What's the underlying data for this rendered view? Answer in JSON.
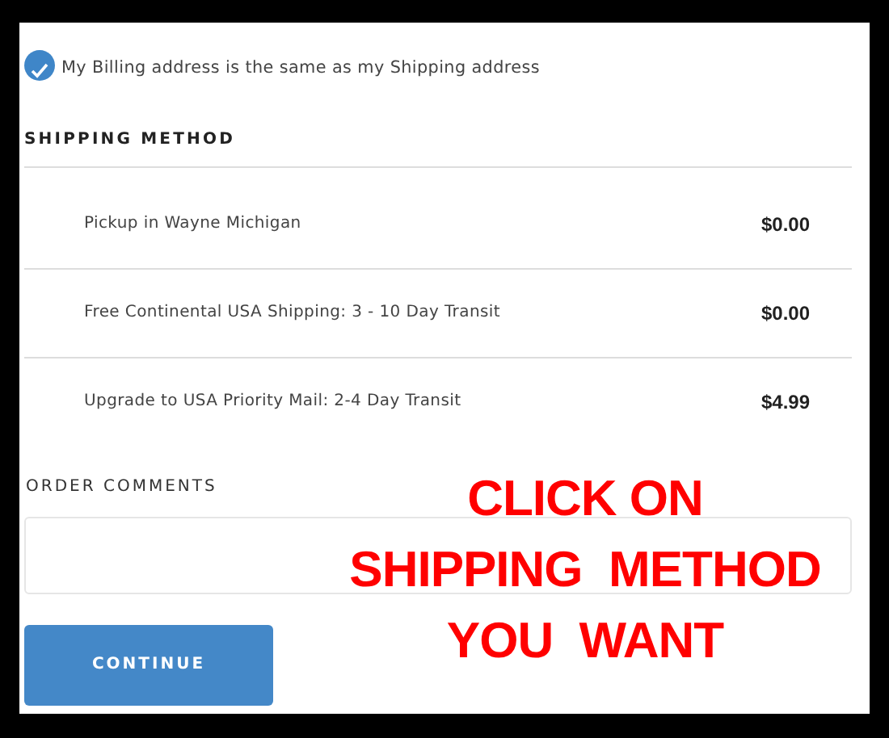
{
  "billing_same_as_shipping": {
    "label": "My Billing address is the same as my Shipping address",
    "checked": true
  },
  "shipping_method": {
    "heading": "SHIPPING METHOD",
    "options": [
      {
        "label": "Pickup in Wayne Michigan",
        "price": "$0.00"
      },
      {
        "label": "Free Continental USA Shipping: 3 - 10 Day Transit",
        "price": "$0.00"
      },
      {
        "label": "Upgrade to USA Priority Mail: 2-4 Day Transit",
        "price": "$4.99"
      }
    ]
  },
  "order_comments": {
    "label": "ORDER COMMENTS"
  },
  "continue_button": "CONTINUE",
  "annotation": [
    "CLICK ON",
    "SHIPPING  METHOD",
    "YOU  WANT"
  ]
}
